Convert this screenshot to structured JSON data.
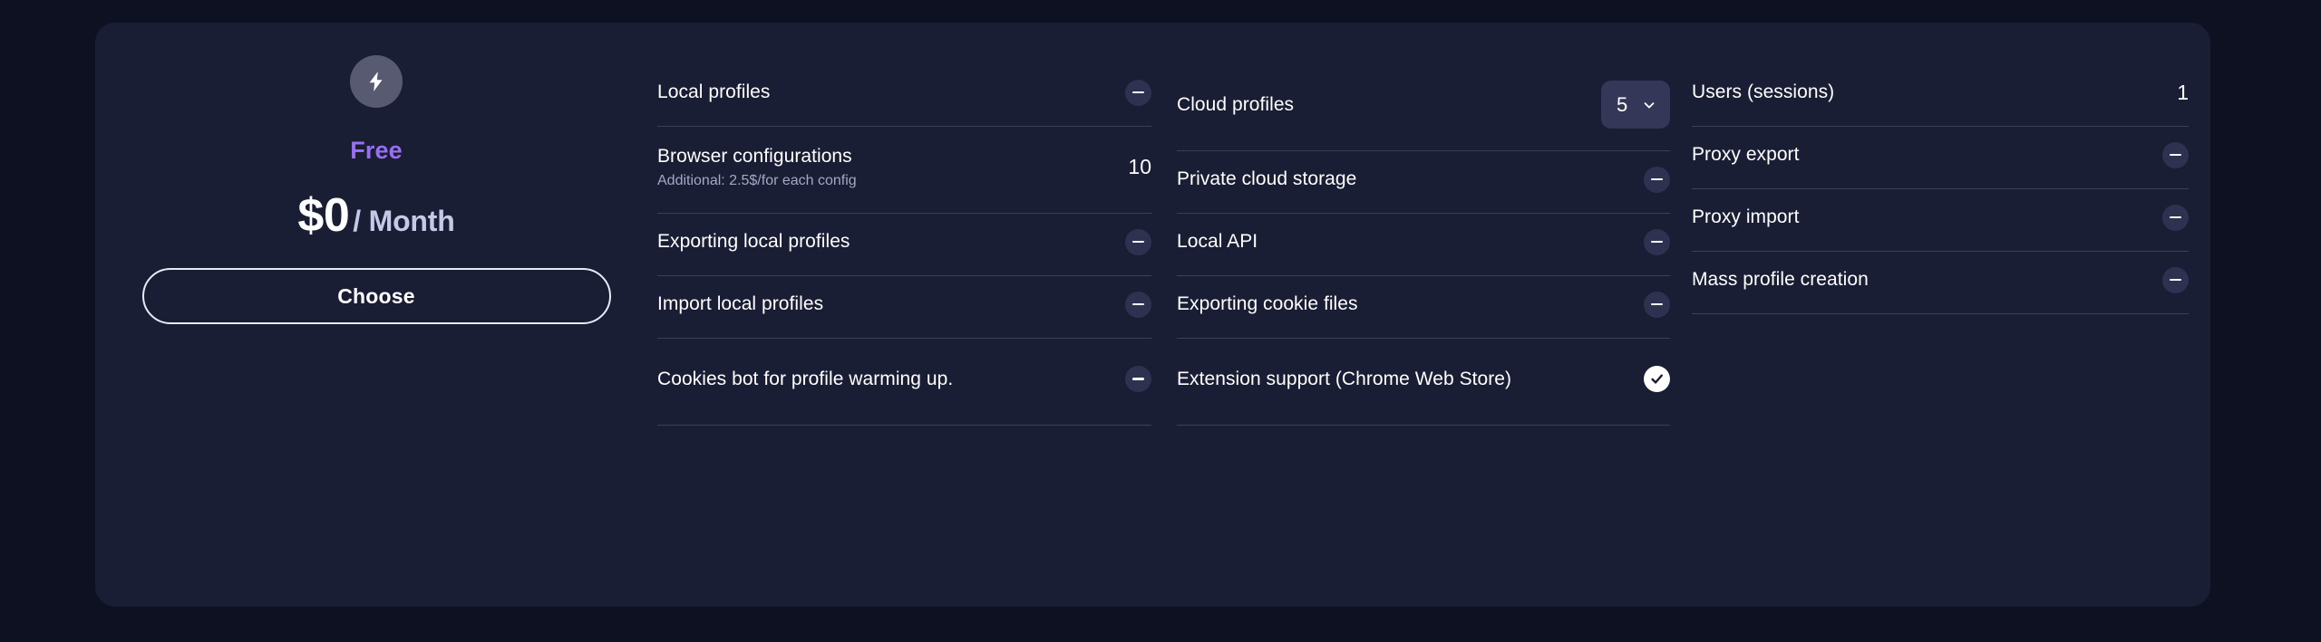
{
  "theme": {
    "page_bg": "#0e1122",
    "card_bg": "#1a1e35",
    "accent": "#9a6ef0",
    "divider": "#3a3f5c",
    "minus_bg": "#2e3250",
    "select_bg": "#343757",
    "badge_bg": "#585a72",
    "text_primary": "#ffffff",
    "text_muted": "#a3a8c4",
    "period_color": "#c6c9e6"
  },
  "plan": {
    "icon": "lightning-bolt-icon",
    "name": "Free",
    "price_amount": "$0",
    "price_period": "/ Month",
    "cta_label": "Choose"
  },
  "features": {
    "columns": [
      {
        "id": "column-1",
        "rows": [
          {
            "label": "Local profiles",
            "sub": "",
            "value_type": "minus",
            "value": ""
          },
          {
            "label": "Browser configurations",
            "sub": "Additional: 2.5$/for each config",
            "value_type": "number",
            "value": "10"
          },
          {
            "label": "Exporting local profiles",
            "sub": "",
            "value_type": "minus",
            "value": ""
          },
          {
            "label": "Import local profiles",
            "sub": "",
            "value_type": "minus",
            "value": ""
          },
          {
            "label": "Cookies bot for profile warming up.",
            "sub": "",
            "value_type": "minus",
            "value": ""
          }
        ]
      },
      {
        "id": "column-2",
        "rows": [
          {
            "label": "Cloud profiles",
            "sub": "",
            "value_type": "select",
            "value": "5"
          },
          {
            "label": "Private cloud storage",
            "sub": "",
            "value_type": "minus",
            "value": ""
          },
          {
            "label": "Local API",
            "sub": "",
            "value_type": "minus",
            "value": ""
          },
          {
            "label": "Exporting cookie files",
            "sub": "",
            "value_type": "minus",
            "value": ""
          },
          {
            "label": "Extension support (Chrome Web Store)",
            "sub": "",
            "value_type": "check",
            "value": ""
          }
        ]
      },
      {
        "id": "column-3",
        "rows": [
          {
            "label": "Users (sessions)",
            "sub": "",
            "value_type": "number",
            "value": "1"
          },
          {
            "label": "Proxy export",
            "sub": "",
            "value_type": "minus",
            "value": ""
          },
          {
            "label": "Proxy import",
            "sub": "",
            "value_type": "minus",
            "value": ""
          },
          {
            "label": "Mass profile creation",
            "sub": "",
            "value_type": "minus",
            "value": ""
          }
        ]
      }
    ]
  }
}
